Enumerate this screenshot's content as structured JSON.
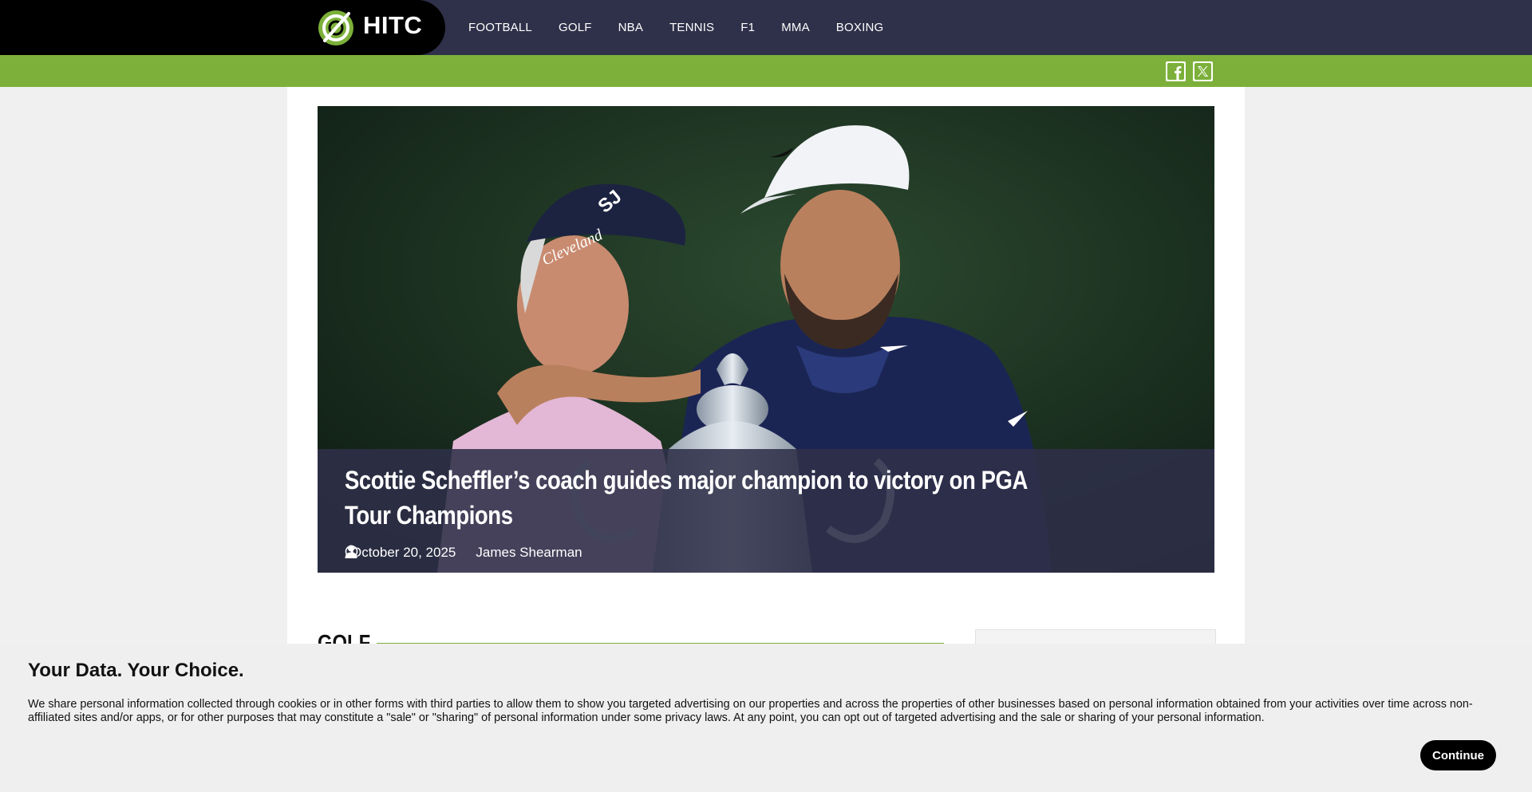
{
  "brand": {
    "name": "HITC",
    "logo_icon": "hitc-logo-icon"
  },
  "nav": {
    "items": [
      {
        "label": "FOOTBALL"
      },
      {
        "label": "GOLF"
      },
      {
        "label": "NBA"
      },
      {
        "label": "TENNIS"
      },
      {
        "label": "F1"
      },
      {
        "label": "MMA"
      },
      {
        "label": "BOXING"
      }
    ]
  },
  "social": {
    "facebook_icon": "facebook-icon",
    "x_icon": "x-twitter-icon"
  },
  "colors": {
    "nav_bg": "#2f3049",
    "accent_green": "#7cb03a",
    "logo_bg": "#000000"
  },
  "article": {
    "title": "Scottie Scheffler’s coach guides major champion to victory on PGA Tour Champions",
    "date": "October 20, 2025",
    "author": "James Shearman"
  },
  "section": {
    "label": "GOLF"
  },
  "consent": {
    "title": "Your Data. Your Choice.",
    "body": "We share personal information collected through cookies or in other forms with third parties to allow them to show you targeted advertising on our properties and across the properties of other businesses based on personal information obtained from your activities over time across non-affiliated sites and/or apps, or for other purposes that may constitute a \"sale\" or \"sharing\" of personal information under some privacy laws. At any point, you can opt out of targeted advertising and the sale or sharing of your personal information.",
    "continue_label": "Continue"
  }
}
